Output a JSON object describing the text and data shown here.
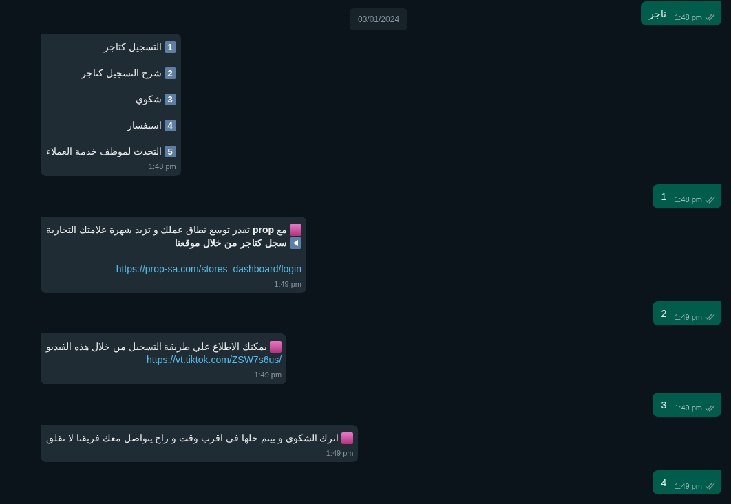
{
  "date_chip": "03/01/2024",
  "messages": [
    {
      "kind": "out",
      "text": "تاجر",
      "time": "1:48 pm"
    },
    {
      "kind": "in",
      "time": "1:48 pm",
      "lines": [
        {
          "kind": "numbered",
          "number": "1",
          "text": "التسجيل كتاجر"
        },
        {
          "kind": "numbered",
          "number": "2",
          "text": "شرح التسجيل كتاجر"
        },
        {
          "kind": "numbered",
          "number": "3",
          "text": "شكوي"
        },
        {
          "kind": "numbered",
          "number": "4",
          "text": "استفسار"
        },
        {
          "kind": "numbered",
          "number": "5",
          "text": "التحدث لموظف خدمة العملاء"
        }
      ]
    },
    {
      "kind": "out",
      "text": "1",
      "time": "1:48 pm"
    },
    {
      "kind": "in",
      "time": "1:49 pm",
      "lines": [
        {
          "kind": "bullet",
          "text": "مع **prop** تقدر توسع نطاق عملك و تزيد شهرة علامتك التجارية"
        },
        {
          "kind": "arrow",
          "text": "سجل كتاجر من خلال موقعنا"
        },
        {
          "kind": "separated-link",
          "text": "https://prop-sa.com/stores_dashboard/login"
        }
      ]
    },
    {
      "kind": "out",
      "text": "2",
      "time": "1:49 pm"
    },
    {
      "kind": "in",
      "time": "1:49 pm",
      "lines": [
        {
          "kind": "bullet",
          "text": "يمكنك الاطلاع علي طريقة التسجيل من خلال هذه الفيديو"
        },
        {
          "kind": "link",
          "text": "https://vt.tiktok.com/ZSW7s6us/"
        }
      ]
    },
    {
      "kind": "out",
      "text": "3",
      "time": "1:49 pm"
    },
    {
      "kind": "in",
      "time": "1:49 pm",
      "lines": [
        {
          "kind": "bullet",
          "text": "اترك الشكوي و بيتم حلها في اقرب وقت و راح يتواصل معك فريقنا لا تقلق"
        }
      ]
    },
    {
      "kind": "out",
      "text": "4",
      "time": "1:49 pm"
    }
  ]
}
